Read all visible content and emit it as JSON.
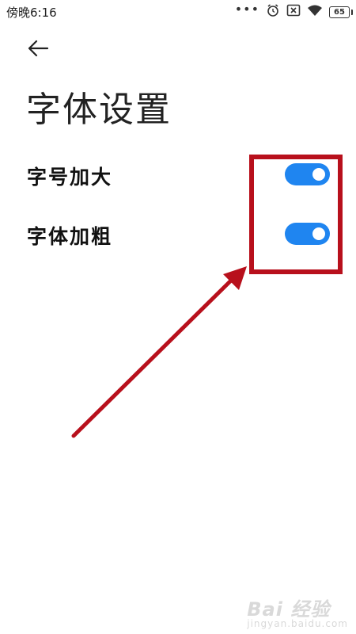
{
  "status_bar": {
    "time": "傍晚6:16",
    "dots": "•••",
    "battery": "65",
    "icons": [
      "alarm-icon",
      "no-sim-icon",
      "wifi-icon",
      "battery-icon"
    ]
  },
  "header": {
    "back_icon": "back-arrow-icon",
    "title": "字体设置"
  },
  "settings": [
    {
      "label": "字号加大",
      "enabled": true
    },
    {
      "label": "字体加粗",
      "enabled": true
    }
  ],
  "colors": {
    "toggle_on": "#1f85f0",
    "annotation": "#b8101c"
  },
  "watermark": {
    "brand": "Bai 经验",
    "sub": "jingyan.baidu.com"
  }
}
